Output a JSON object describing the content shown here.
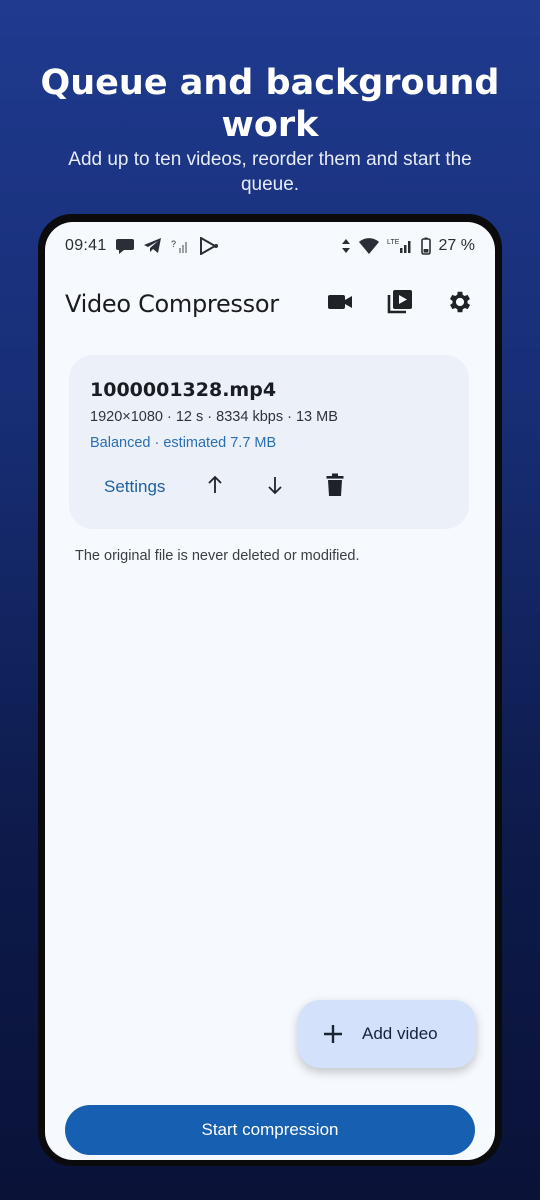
{
  "promo": {
    "title": "Queue and background work",
    "subtitle": "Add up to ten videos, reorder them and start the queue."
  },
  "statusbar": {
    "time": "09:41",
    "battery": "27 %",
    "left_icons": [
      "chat-icon",
      "telegram-icon",
      "no-signal-icon",
      "play-store-icon"
    ],
    "right_icons": [
      "data-arrows-icon",
      "wifi-icon",
      "lte-signal-icon",
      "battery-icon"
    ]
  },
  "appbar": {
    "title": "Video Compressor",
    "actions": [
      "record-video-icon",
      "video-library-icon",
      "settings-gear-icon"
    ]
  },
  "queue": [
    {
      "filename": "1000001328.mp4",
      "meta": "1920×1080 · 12 s · 8334 kbps · 13 MB",
      "estimate": "Balanced · estimated 7.7 MB",
      "settings_label": "Settings"
    }
  ],
  "note": "The original file is never deleted or modified.",
  "fab": {
    "label": "Add video"
  },
  "start_button": {
    "label": "Start compression"
  },
  "colors": {
    "primary": "#175fb0",
    "accent_text": "#2a6fb4",
    "card_bg": "#ebf0f9",
    "fab_bg": "#d3e2fa"
  }
}
